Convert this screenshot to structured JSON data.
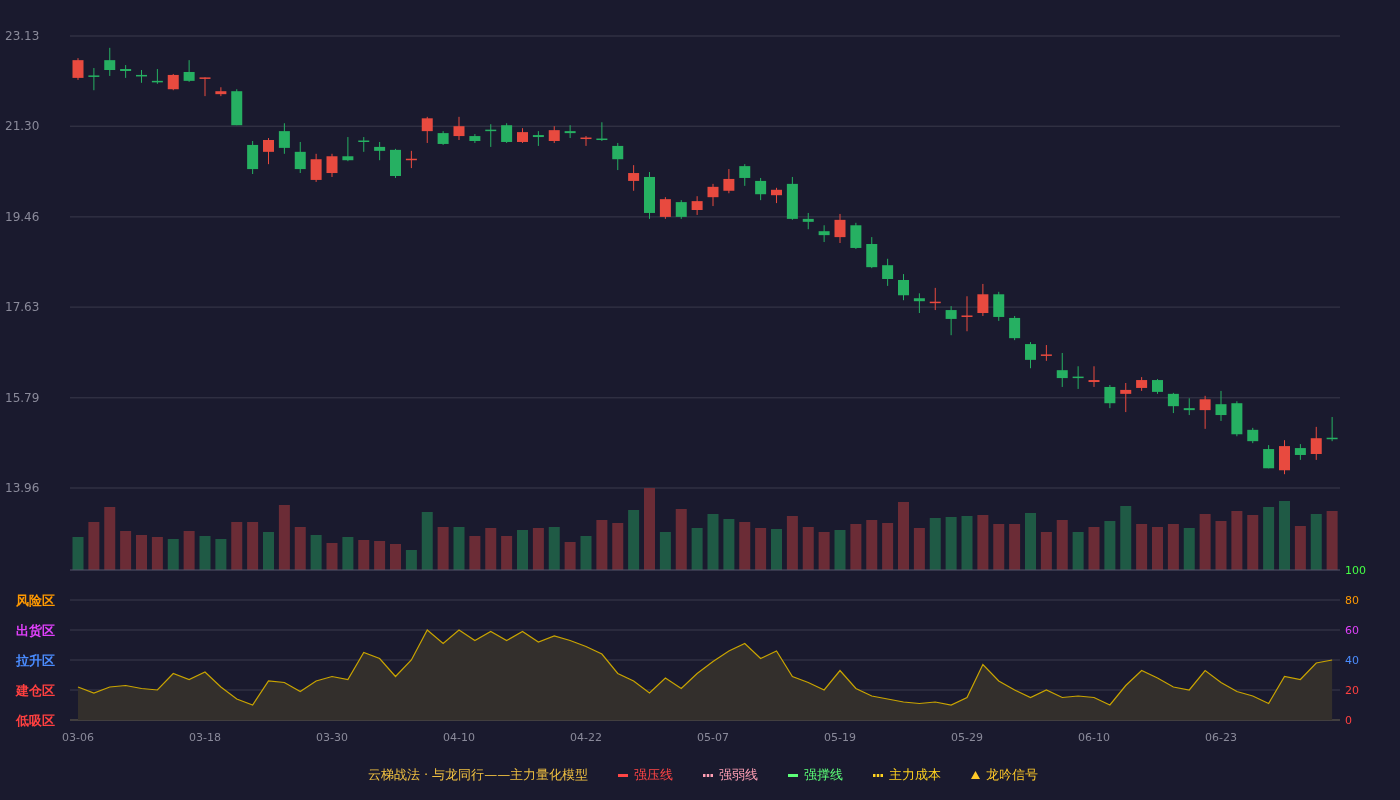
{
  "price_chart": {
    "chart_data": {
      "type": "candlestick",
      "grid": true,
      "categories": [
        null,
        null,
        null,
        null,
        null,
        null,
        null,
        null,
        null,
        null,
        null,
        null,
        null,
        null,
        null,
        null,
        null,
        null,
        null,
        null,
        null,
        null,
        null,
        null,
        null,
        null,
        null,
        null,
        null,
        null,
        null,
        null,
        null,
        null,
        null,
        null,
        null,
        null,
        null,
        null,
        null,
        null,
        null,
        null,
        null,
        null,
        null,
        null,
        null,
        null,
        null,
        null,
        null,
        null,
        null,
        null,
        null,
        null,
        null,
        null,
        null,
        null,
        null,
        null,
        null,
        null,
        null,
        null,
        null,
        null,
        null,
        null,
        null,
        null,
        null,
        null,
        null,
        null,
        null,
        null
      ],
      "yticks": [
        {
          "value": 23.13,
          "label": "23.13"
        },
        {
          "value": 21.3,
          "label": "21.30"
        },
        {
          "value": 19.46,
          "label": "19.46"
        },
        {
          "value": 17.63,
          "label": "17.63"
        },
        {
          "value": 15.79,
          "label": "15.79"
        },
        {
          "value": 13.96,
          "label": "13.96"
        }
      ],
      "ylim": [
        13.96,
        23.13
      ],
      "ohlc": [
        [
          22.28,
          22.68,
          22.24,
          22.64
        ],
        [
          22.33,
          22.48,
          22.03,
          22.32
        ],
        [
          22.64,
          22.89,
          22.32,
          22.44
        ],
        [
          22.46,
          22.54,
          22.28,
          22.42
        ],
        [
          22.34,
          22.44,
          22.18,
          22.32
        ],
        [
          22.22,
          22.46,
          22.16,
          22.2
        ],
        [
          22.05,
          22.36,
          22.03,
          22.34
        ],
        [
          22.4,
          22.64,
          22.2,
          22.22
        ],
        [
          22.28,
          22.29,
          21.91,
          22.29
        ],
        [
          21.95,
          22.09,
          21.91,
          22.01
        ],
        [
          22.01,
          22.05,
          21.32,
          21.32
        ],
        [
          20.92,
          21.0,
          20.33,
          20.43
        ],
        [
          20.78,
          21.06,
          20.53,
          21.02
        ],
        [
          21.2,
          21.36,
          20.74,
          20.86
        ],
        [
          20.78,
          20.98,
          20.35,
          20.43
        ],
        [
          20.21,
          20.74,
          20.17,
          20.63
        ],
        [
          20.35,
          20.74,
          20.27,
          20.69
        ],
        [
          20.69,
          21.08,
          20.59,
          20.61
        ],
        [
          21.01,
          21.08,
          20.78,
          21.0
        ],
        [
          20.88,
          20.98,
          20.61,
          20.8
        ],
        [
          20.82,
          20.84,
          20.25,
          20.29
        ],
        [
          20.63,
          20.8,
          20.45,
          20.64
        ],
        [
          21.2,
          21.49,
          20.96,
          21.46
        ],
        [
          21.16,
          21.2,
          20.92,
          20.94
        ],
        [
          21.1,
          21.49,
          21.02,
          21.3
        ],
        [
          21.1,
          21.14,
          20.96,
          21.0
        ],
        [
          21.23,
          21.34,
          20.88,
          21.22
        ],
        [
          21.32,
          21.36,
          20.96,
          20.98
        ],
        [
          20.98,
          21.26,
          20.96,
          21.18
        ],
        [
          21.12,
          21.2,
          20.9,
          21.08
        ],
        [
          21.0,
          21.3,
          20.96,
          21.22
        ],
        [
          21.2,
          21.32,
          21.06,
          21.16
        ],
        [
          21.06,
          21.1,
          20.9,
          21.07
        ],
        [
          21.05,
          21.38,
          21.0,
          21.04
        ],
        [
          20.9,
          20.96,
          20.41,
          20.63
        ],
        [
          20.19,
          20.51,
          19.99,
          20.35
        ],
        [
          20.27,
          20.37,
          19.42,
          19.54
        ],
        [
          19.46,
          19.86,
          19.42,
          19.82
        ],
        [
          19.76,
          19.8,
          19.42,
          19.46
        ],
        [
          19.6,
          19.88,
          19.5,
          19.78
        ],
        [
          19.86,
          20.13,
          19.68,
          20.07
        ],
        [
          19.99,
          20.43,
          19.94,
          20.23
        ],
        [
          20.49,
          20.53,
          20.09,
          20.25
        ],
        [
          20.19,
          20.25,
          19.8,
          19.92
        ],
        [
          19.9,
          20.05,
          19.74,
          20.01
        ],
        [
          20.13,
          20.27,
          19.4,
          19.42
        ],
        [
          19.42,
          19.54,
          19.21,
          19.36
        ],
        [
          19.17,
          19.29,
          18.95,
          19.09
        ],
        [
          19.05,
          19.52,
          18.93,
          19.4
        ],
        [
          19.29,
          19.34,
          18.81,
          18.83
        ],
        [
          18.91,
          19.05,
          18.42,
          18.44
        ],
        [
          18.48,
          18.61,
          18.06,
          18.2
        ],
        [
          18.18,
          18.3,
          17.77,
          17.87
        ],
        [
          17.81,
          17.91,
          17.51,
          17.75
        ],
        [
          17.73,
          18.02,
          17.57,
          17.74
        ],
        [
          17.57,
          17.65,
          17.06,
          17.39
        ],
        [
          17.45,
          17.85,
          17.14,
          17.46
        ],
        [
          17.51,
          18.1,
          17.45,
          17.89
        ],
        [
          17.89,
          17.94,
          17.35,
          17.43
        ],
        [
          17.41,
          17.45,
          16.96,
          17.0
        ],
        [
          16.88,
          16.92,
          16.39,
          16.56
        ],
        [
          16.66,
          16.86,
          16.54,
          16.67
        ],
        [
          16.35,
          16.7,
          16.01,
          16.19
        ],
        [
          16.22,
          16.43,
          15.97,
          16.21
        ],
        [
          16.11,
          16.43,
          16.01,
          16.15
        ],
        [
          16.01,
          16.05,
          15.58,
          15.68
        ],
        [
          15.87,
          16.09,
          15.5,
          15.95
        ],
        [
          15.99,
          16.21,
          15.93,
          16.15
        ],
        [
          16.15,
          16.17,
          15.87,
          15.91
        ],
        [
          15.87,
          15.89,
          15.48,
          15.62
        ],
        [
          15.58,
          15.78,
          15.44,
          15.54
        ],
        [
          15.54,
          15.83,
          15.16,
          15.76
        ],
        [
          15.66,
          15.93,
          15.32,
          15.44
        ],
        [
          15.68,
          15.72,
          15.01,
          15.05
        ],
        [
          15.14,
          15.18,
          14.87,
          14.91
        ],
        [
          14.75,
          14.83,
          14.36,
          14.36
        ],
        [
          14.32,
          14.93,
          14.24,
          14.81
        ],
        [
          14.77,
          14.85,
          14.53,
          14.63
        ],
        [
          14.65,
          15.2,
          14.53,
          14.97
        ],
        [
          14.98,
          15.4,
          14.91,
          14.97
        ]
      ]
    }
  },
  "indicator_chart": {
    "zones": [
      {
        "label": "风险区",
        "color": "#ff9900"
      },
      {
        "label": "出货区",
        "color": "#e040fb"
      },
      {
        "label": "拉升区",
        "color": "#4a8cff"
      },
      {
        "label": "建仓区",
        "color": "#ff4040"
      },
      {
        "label": "低吸区",
        "color": "#ff4040"
      }
    ],
    "tick_colors": [
      {
        "color": "#44ff44"
      },
      {
        "color": "#ff9900"
      },
      {
        "color": "#e040fb"
      },
      {
        "color": "#4a8cff"
      },
      {
        "color": "#ff4040"
      },
      {
        "color": "#ff4040"
      }
    ],
    "chart_data": {
      "type": "area",
      "grid": true,
      "ylim": [
        0,
        100
      ],
      "categories": [
        "03-06",
        null,
        null,
        null,
        null,
        null,
        null,
        null,
        "03-18",
        null,
        null,
        null,
        null,
        null,
        null,
        null,
        "03-30",
        null,
        null,
        null,
        null,
        null,
        null,
        null,
        "04-10",
        null,
        null,
        null,
        null,
        null,
        null,
        null,
        "04-22",
        null,
        null,
        null,
        null,
        null,
        null,
        null,
        "05-07",
        null,
        null,
        null,
        null,
        null,
        null,
        null,
        "05-19",
        null,
        null,
        null,
        null,
        null,
        null,
        null,
        "05-29",
        null,
        null,
        null,
        null,
        null,
        null,
        null,
        "06-10",
        null,
        null,
        null,
        null,
        null,
        null,
        null,
        "06-23",
        null,
        null,
        null,
        null,
        null,
        null,
        null
      ],
      "yticks": [
        {
          "value": 100,
          "label": "100"
        },
        {
          "value": 80,
          "label": "80"
        },
        {
          "value": 60,
          "label": "60"
        },
        {
          "value": 40,
          "label": "40"
        },
        {
          "value": 20,
          "label": "20"
        },
        {
          "value": 0,
          "label": "0"
        }
      ],
      "series": [
        {
          "color": "#c9a400",
          "values": [
            22,
            18,
            22,
            23,
            21,
            20,
            31,
            27,
            32,
            22,
            14,
            10,
            26,
            25,
            19,
            26,
            29,
            27,
            45,
            41,
            29,
            40,
            60,
            51,
            60,
            53,
            59,
            53,
            59,
            52,
            56,
            53,
            49,
            44,
            31,
            26,
            18,
            28,
            21,
            31,
            39,
            46,
            51,
            41,
            46,
            29,
            25,
            20,
            33,
            21,
            16,
            14,
            12,
            11,
            12,
            10,
            15,
            37,
            26,
            20,
            15,
            20,
            15,
            16,
            15,
            10,
            23,
            33,
            28,
            22,
            20,
            33,
            25,
            19,
            16,
            11,
            29,
            27,
            38,
            40
          ]
        }
      ]
    }
  },
  "legend": {
    "title": "云梯战法 · 与龙同行——主力量化模型",
    "items": [
      {
        "kind": "line",
        "label": "强压线",
        "color": "#ff4545"
      },
      {
        "kind": "dash",
        "label": "强弱线",
        "color": "#ff9fb4"
      },
      {
        "kind": "line",
        "label": "强撑线",
        "color": "#5cff78"
      },
      {
        "kind": "dash",
        "label": "主力成本",
        "color": "#ffd21f"
      },
      {
        "kind": "triangle",
        "label": "龙吟信号",
        "color": "#ffc928"
      }
    ]
  }
}
